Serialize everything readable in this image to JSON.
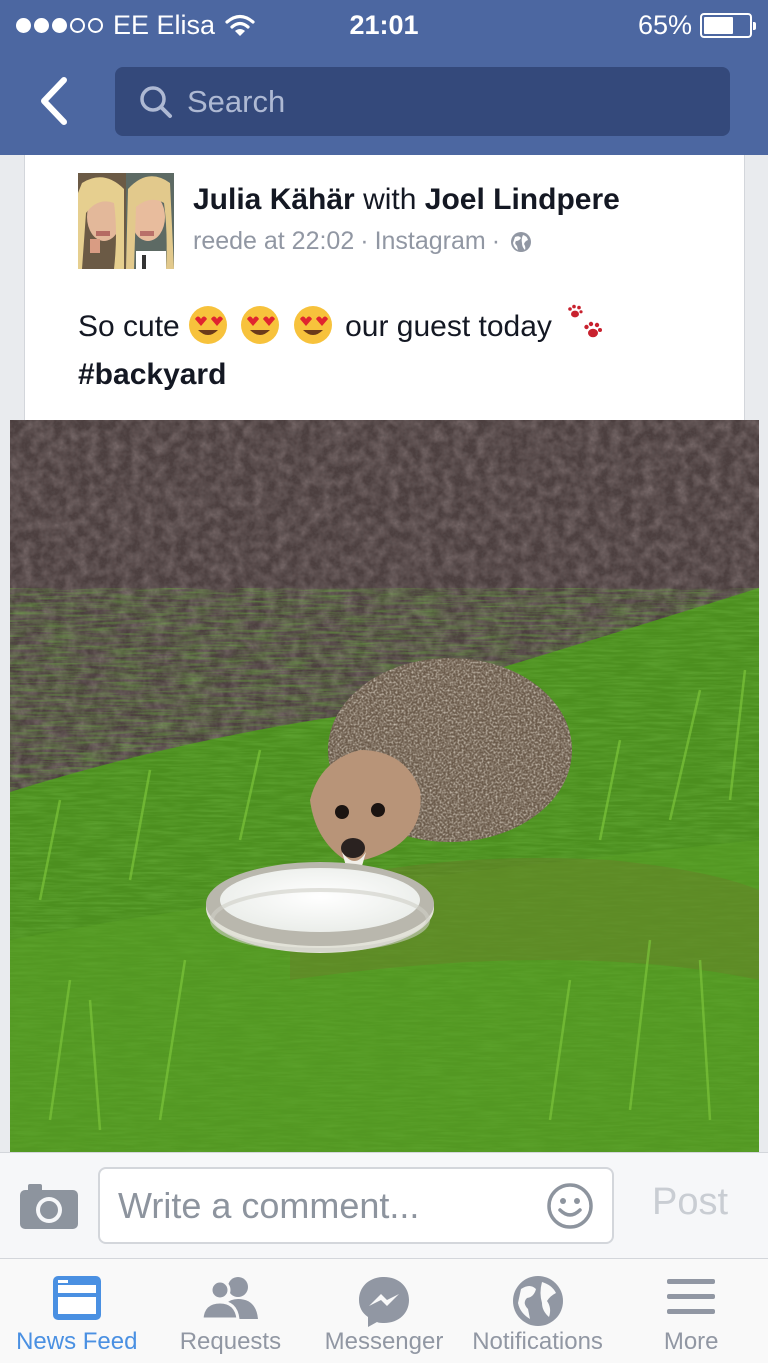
{
  "status_bar": {
    "carrier": "EE Elisa",
    "signal_dots_filled": 3,
    "signal_dots_total": 5,
    "time": "21:01",
    "battery_percent_label": "65%",
    "battery_level": 0.65
  },
  "header": {
    "back_icon": "chevron-left-icon",
    "search_placeholder": "Search",
    "search_icon": "search-icon"
  },
  "post": {
    "author": "Julia Kähär",
    "with_word": "with",
    "tagged": "Joel Lindpere",
    "time": "reede at 22:02",
    "separator": "·",
    "source": "Instagram",
    "privacy_icon": "globe-icon",
    "text_before": "So cute",
    "emojis": [
      "heart-eyes-emoji",
      "heart-eyes-emoji",
      "heart-eyes-emoji"
    ],
    "text_after": "our guest today",
    "paws_icon": "paw-prints-icon",
    "hashtag": "#backyard",
    "photo_description_icon": "hedgehog-photo"
  },
  "comment_bar": {
    "camera_icon": "camera-icon",
    "placeholder": "Write a comment...",
    "smiley_icon": "smiley-icon",
    "post_label": "Post"
  },
  "tabs": [
    {
      "label": "News Feed",
      "icon": "news-feed-icon",
      "active": true
    },
    {
      "label": "Requests",
      "icon": "requests-icon",
      "active": false
    },
    {
      "label": "Messenger",
      "icon": "messenger-icon",
      "active": false
    },
    {
      "label": "Notifications",
      "icon": "globe-icon",
      "active": false
    },
    {
      "label": "More",
      "icon": "menu-icon",
      "active": false
    }
  ],
  "colors": {
    "brand_blue": "#4c67a1",
    "search_bg": "#34497b",
    "active_tab": "#4a90e2",
    "inactive_tab": "#9197a3"
  }
}
